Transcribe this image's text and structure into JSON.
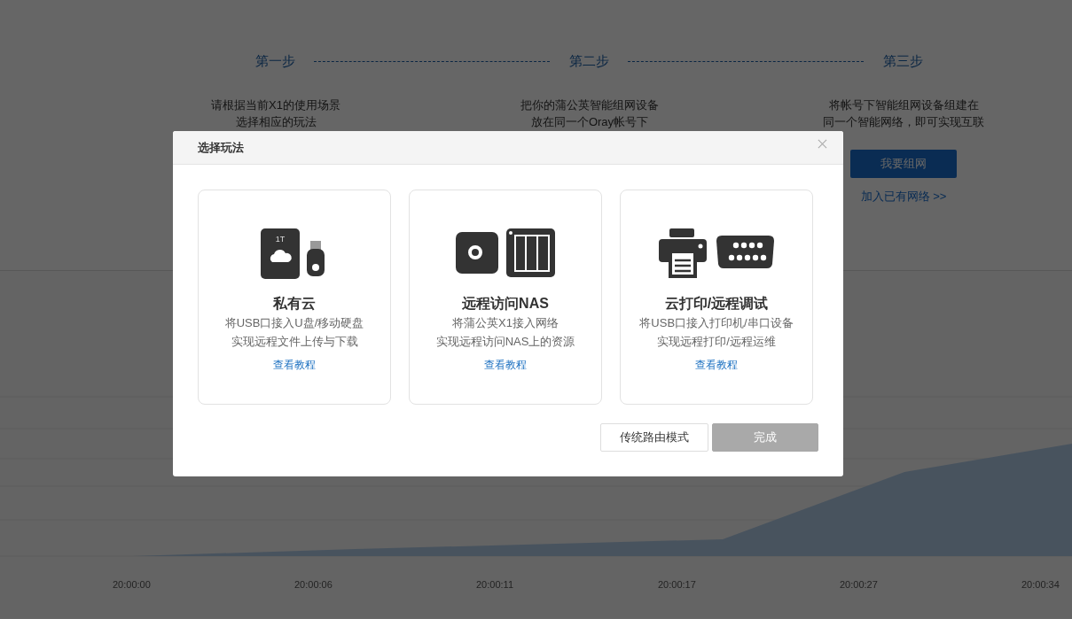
{
  "steps": [
    {
      "label": "第一步",
      "lines": [
        "请根据当前X1的使用场景",
        "选择相应的玩法"
      ]
    },
    {
      "label": "第二步",
      "lines": [
        "把你的蒲公英智能组网设备",
        "放在同一个Oray帐号下"
      ]
    },
    {
      "label": "第三步",
      "lines": [
        "将帐号下智能组网设备组建在",
        "同一个智能网络，即可实现互联"
      ]
    }
  ],
  "network_button": "我要组网",
  "join_link": "加入已有网络 >>",
  "chart": {
    "x_labels": [
      "20:00:00",
      "20:00:06",
      "20:00:11",
      "20:00:17",
      "20:00:27",
      "20:00:34"
    ]
  },
  "dialog": {
    "title": "选择玩法",
    "cards": [
      {
        "kind": "cloud",
        "title": "私有云",
        "lines": [
          "将USB口接入U盘/移动硬盘",
          "实现远程文件上传与下载"
        ],
        "link": "查看教程",
        "icon_label": "1T"
      },
      {
        "kind": "nas",
        "title": "远程访问NAS",
        "lines": [
          "将蒲公英X1接入网络",
          "实现远程访问NAS上的资源"
        ],
        "link": "查看教程"
      },
      {
        "kind": "print",
        "title": "云打印/远程调试",
        "lines": [
          "将USB口接入打印机/串口设备",
          "实现远程打印/远程运维"
        ],
        "link": "查看教程"
      }
    ],
    "buttons": [
      {
        "label": "传统路由模式",
        "disabled": false
      },
      {
        "label": "完成",
        "disabled": true
      }
    ]
  }
}
